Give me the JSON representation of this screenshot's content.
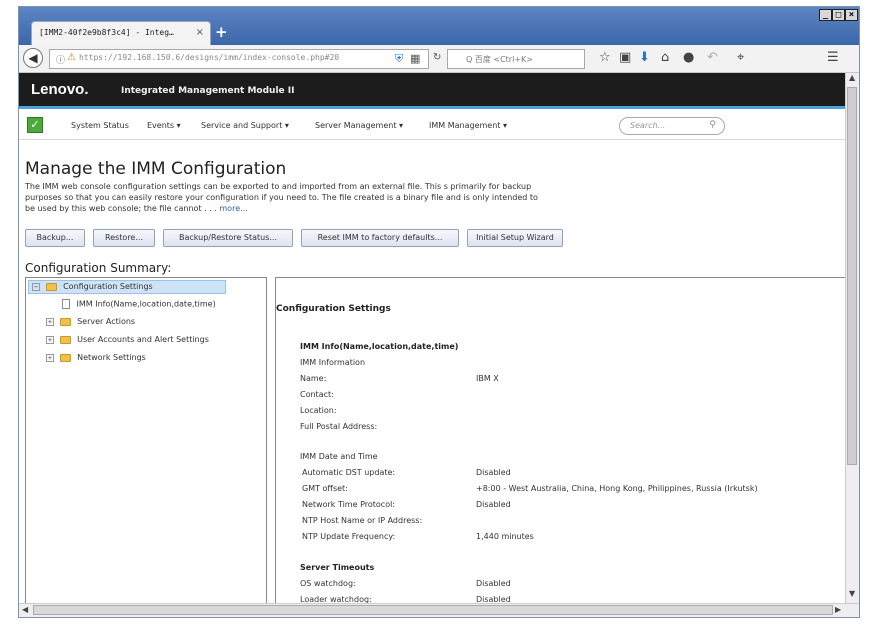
{
  "browser": {
    "tab_title": "[IMM2-40f2e9b8f3c4] - Integ…",
    "tab_close": "×",
    "new_tab": "+",
    "url": "https://192.168.150.6/designs/imm/index-console.php#20",
    "search_placeholder": "Q 百度 <Ctrl+K>",
    "window_buttons": [
      "_",
      "□",
      "×"
    ]
  },
  "header": {
    "logo": "Lenovo.",
    "product": "Integrated Management Module II"
  },
  "menu": {
    "items": [
      "System Status",
      "Events ▾",
      "Service and Support ▾",
      "Server Management ▾",
      "IMM Management ▾"
    ],
    "search_placeholder": "Search..."
  },
  "page": {
    "title": "Manage the IMM Configuration",
    "desc_lines": [
      "The IMM web console configuration settings can be exported to and imported from an external file. This s primarily for backup",
      "purposes so that you can easily restore your configuration if you need to. The file created is a binary file and is only intended to",
      "be used by this web console; the file cannot . . ."
    ],
    "more_link": "more...",
    "buttons": [
      "Backup...",
      "Restore...",
      "Backup/Restore Status...",
      "Reset IMM to factory defaults...",
      "Initial Setup Wizard"
    ],
    "summary_title": "Configuration Summary:"
  },
  "tree": {
    "root": "Configuration Settings",
    "children": [
      "IMM Info(Name,location,date,time)",
      "Server Actions",
      "User Accounts and Alert Settings",
      "Network Settings"
    ]
  },
  "details": {
    "title": "Configuration Settings",
    "section1": "IMM Info(Name,location,date,time)",
    "imm_info_head": "IMM Information",
    "imm_info": [
      {
        "label": "Name:",
        "value": "IBM X"
      },
      {
        "label": "Contact:",
        "value": ""
      },
      {
        "label": "Location:",
        "value": ""
      },
      {
        "label": "Full Postal Address:",
        "value": ""
      }
    ],
    "datetime_head": "IMM Date and Time",
    "datetime": [
      {
        "label": "Automatic DST update:",
        "value": "Disabled"
      },
      {
        "label": "GMT offset:",
        "value": "+8:00 - West Australia, China, Hong Kong, Philippines, Russia (Irkutsk)"
      },
      {
        "label": "Network Time Protocol:",
        "value": "Disabled"
      },
      {
        "label": "NTP Host Name or IP Address:",
        "value": ""
      },
      {
        "label": "NTP Update Frequency:",
        "value": "1,440 minutes"
      }
    ],
    "timeouts_head": "Server Timeouts",
    "timeouts": [
      {
        "label": "OS watchdog:",
        "value": "Disabled"
      },
      {
        "label": "Loader watchdog:",
        "value": "Disabled"
      }
    ]
  }
}
